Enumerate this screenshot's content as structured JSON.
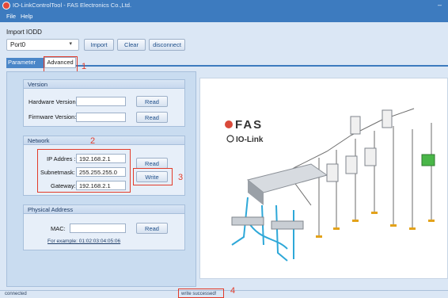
{
  "window": {
    "title": "IO-LinkControlTool - FAS Electronics Co.,Ltd.",
    "minimize_glyph": "–"
  },
  "menu": {
    "file": "File",
    "help": "Help"
  },
  "import_iodd": {
    "label": "Import IODD",
    "port_value": "Port0",
    "import_label": "Import",
    "clear_label": "Clear",
    "disconnect_label": "disconnect"
  },
  "tabs": {
    "parameter": "Parameter",
    "advanced": "Advanced"
  },
  "version": {
    "title": "Version",
    "hardware_label": "Hardware Version:",
    "firmware_label": "Firmware Version:",
    "read_label": "Read"
  },
  "network": {
    "title": "Network",
    "ip_label": "IP Addres :",
    "ip_value": "192.168.2.1",
    "subnet_label": "Subnetmask:",
    "subnet_value": "255.255.255.0",
    "gateway_label": "Gateway:",
    "gateway_value": "192.168.2.1",
    "read_label": "Read",
    "write_label": "Write"
  },
  "physical": {
    "title": "Physical Address",
    "mac_label": "MAC:",
    "read_label": "Read",
    "example": "For example: 01:02:03:04:05:06"
  },
  "image": {
    "brand": "FAS",
    "protocol": "IO-Link"
  },
  "annotations": {
    "n1": "1",
    "n2": "2",
    "n3": "3",
    "n4": "4"
  },
  "status": {
    "left": "connected",
    "message": "write successed!"
  },
  "colors": {
    "accent": "#3d7bbf",
    "annotation": "#e23b2a",
    "panel": "#c9dcf0"
  }
}
